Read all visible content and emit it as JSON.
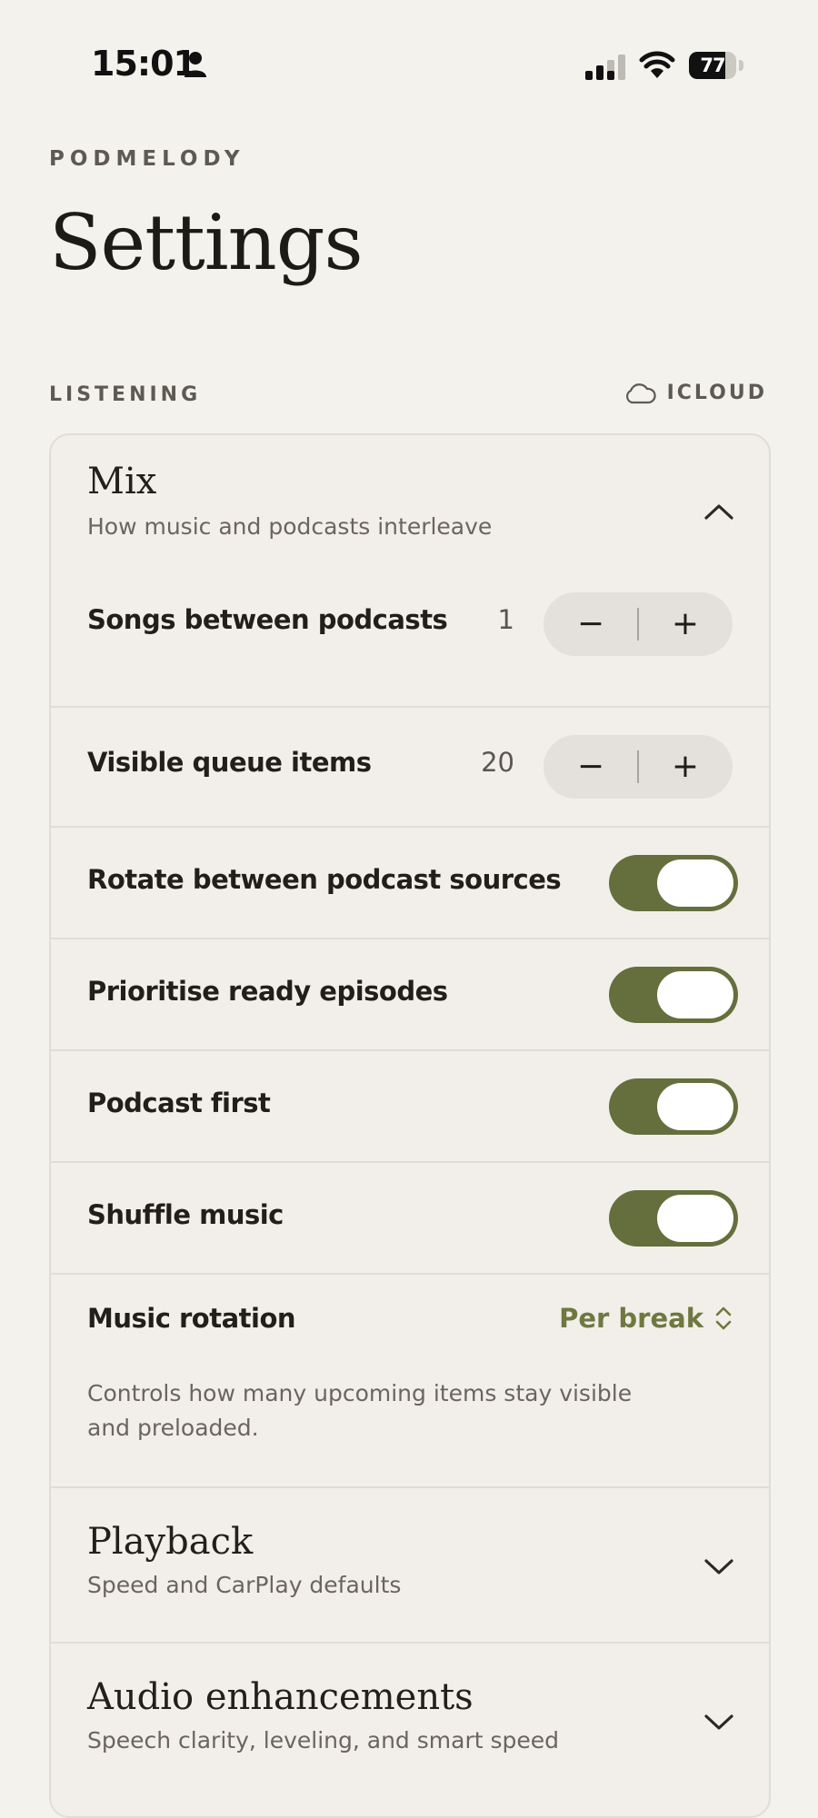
{
  "status_bar": {
    "time": "15:01",
    "battery": "77",
    "battery_level": 0.77
  },
  "app": {
    "brand": "PODMELODY",
    "title": "Settings"
  },
  "section": {
    "label": "LISTENING",
    "sync_label": "ICLOUD",
    "sync_icon": "cloud-icon"
  },
  "mix": {
    "title": "Mix",
    "subtitle": "How music and podcasts interleave",
    "expanded": true,
    "songs_between": {
      "label": "Songs between podcasts",
      "value": "1",
      "minus": "−",
      "plus": "+"
    },
    "visible_queue": {
      "label": "Visible queue items",
      "value": "20",
      "minus": "−",
      "plus": "+"
    },
    "rotate_sources": {
      "label": "Rotate between podcast sources",
      "on": true
    },
    "prioritise_ready": {
      "label": "Prioritise ready episodes",
      "on": true
    },
    "podcast_first": {
      "label": "Podcast first",
      "on": true
    },
    "shuffle_music": {
      "label": "Shuffle music",
      "on": true
    },
    "music_rotation": {
      "label": "Music rotation",
      "value": "Per break"
    },
    "note": "Controls how many upcoming items stay visible and preloaded."
  },
  "playback": {
    "title": "Playback",
    "subtitle": "Speed and CarPlay defaults"
  },
  "audio": {
    "title": "Audio enhancements",
    "subtitle": "Speech clarity, leveling, and smart speed"
  },
  "colors": {
    "accent": "#646f3d",
    "accent_text": "#6f7840",
    "background": "#f4f2ed"
  }
}
